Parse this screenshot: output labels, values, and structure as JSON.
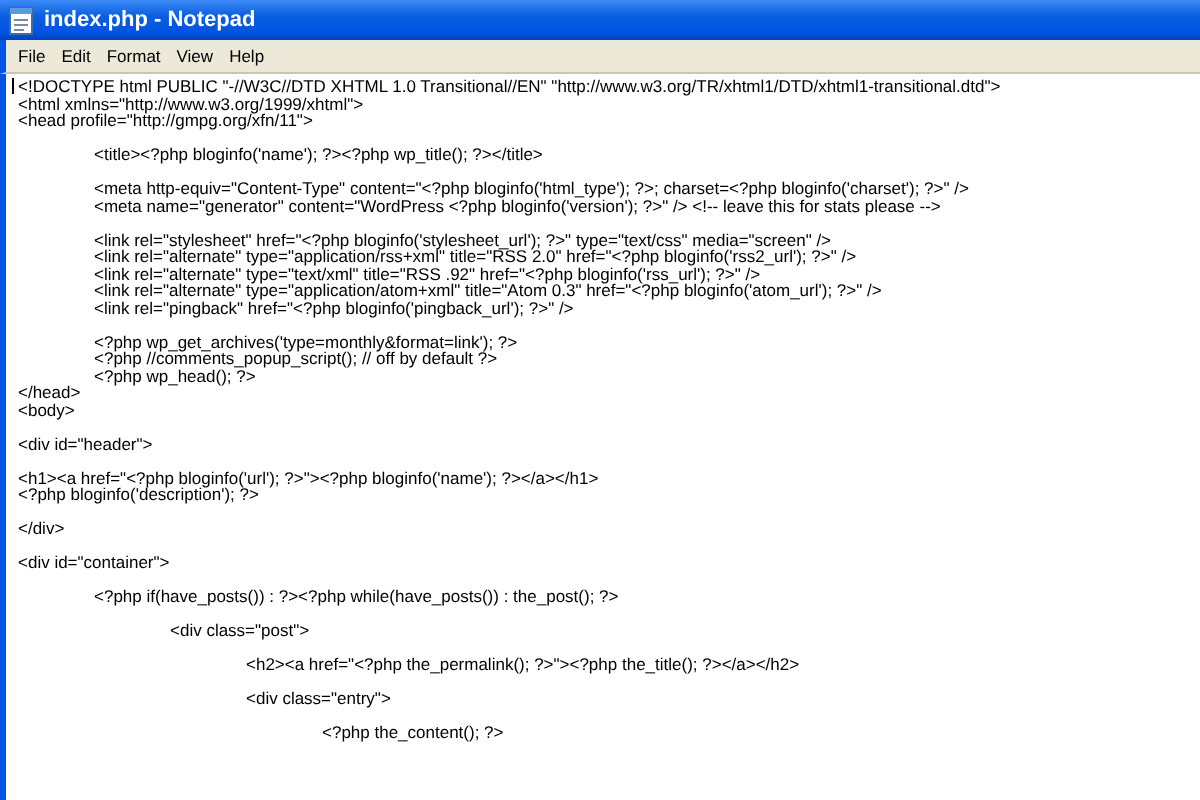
{
  "window": {
    "title": "index.php - Notepad"
  },
  "menu": [
    "File",
    "Edit",
    "Format",
    "View",
    "Help"
  ],
  "editor": {
    "blocks": [
      [
        "<!DOCTYPE html PUBLIC \"-//W3C//DTD XHTML 1.0 Transitional//EN\" \"http://www.w3.org/TR/xhtml1/DTD/xhtml1-transitional.dtd\">",
        "<html xmlns=\"http://www.w3.org/1999/xhtml\">",
        "<head profile=\"http://gmpg.org/xfn/11\">"
      ],
      [
        "\t<title><?php bloginfo('name'); ?><?php wp_title(); ?></title>"
      ],
      [
        "\t<meta http-equiv=\"Content-Type\" content=\"<?php bloginfo('html_type'); ?>; charset=<?php bloginfo('charset'); ?>\" />",
        "\t<meta name=\"generator\" content=\"WordPress <?php bloginfo('version'); ?>\" /> <!-- leave this for stats please -->"
      ],
      [
        "\t<link rel=\"stylesheet\" href=\"<?php bloginfo('stylesheet_url'); ?>\" type=\"text/css\" media=\"screen\" />",
        "\t<link rel=\"alternate\" type=\"application/rss+xml\" title=\"RSS 2.0\" href=\"<?php bloginfo('rss2_url'); ?>\" />",
        "\t<link rel=\"alternate\" type=\"text/xml\" title=\"RSS .92\" href=\"<?php bloginfo('rss_url'); ?>\" />",
        "\t<link rel=\"alternate\" type=\"application/atom+xml\" title=\"Atom 0.3\" href=\"<?php bloginfo('atom_url'); ?>\" />",
        "\t<link rel=\"pingback\" href=\"<?php bloginfo('pingback_url'); ?>\" />"
      ],
      [
        "\t<?php wp_get_archives('type=monthly&format=link'); ?>",
        "\t<?php //comments_popup_script(); // off by default ?>",
        "\t<?php wp_head(); ?>",
        "</head>",
        "<body>"
      ],
      [
        "<div id=\"header\">"
      ],
      [
        "<h1><a href=\"<?php bloginfo('url'); ?>\"><?php bloginfo('name'); ?></a></h1>",
        "<?php bloginfo('description'); ?>"
      ],
      [
        "</div>"
      ],
      [
        "<div id=\"container\">"
      ],
      [
        "\t<?php if(have_posts()) : ?><?php while(have_posts()) : the_post(); ?>"
      ],
      [
        "\t\t<div class=\"post\">"
      ],
      [
        "\t\t\t<h2><a href=\"<?php the_permalink(); ?>\"><?php the_title(); ?></a></h2>"
      ],
      [
        "\t\t\t<div class=\"entry\">"
      ],
      [
        "\t\t\t\t<?php the_content(); ?>"
      ]
    ]
  }
}
